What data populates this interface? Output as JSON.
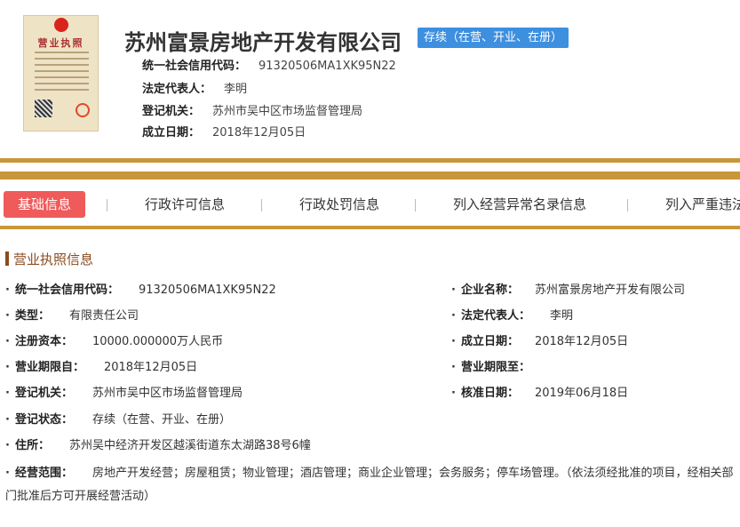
{
  "header": {
    "license_image": {
      "title": "营业执照"
    },
    "company_name": "苏州富景房地产开发有限公司",
    "status_tag": "存续（在营、开业、在册）",
    "credit_code_label": "统一社会信用代码：",
    "credit_code": "91320506MA1XK95N22",
    "legal_rep_label": "法定代表人：",
    "legal_rep": "李明",
    "authority_label": "登记机关：",
    "authority": "苏州市吴中区市场监督管理局",
    "founded_label": "成立日期：",
    "founded": "2018年12月05日"
  },
  "tabs": [
    {
      "label": "基础信息"
    },
    {
      "label": "行政许可信息"
    },
    {
      "label": "行政处罚信息"
    },
    {
      "label": "列入经营异常名录信息"
    },
    {
      "label": "列入严重违法"
    }
  ],
  "section": {
    "title": "营业执照信息"
  },
  "fields": {
    "credit_code": {
      "label": "统一社会信用代码：",
      "value": "91320506MA1XK95N22"
    },
    "company_name": {
      "label": "企业名称：",
      "value": "苏州富景房地产开发有限公司"
    },
    "type": {
      "label": "类型：",
      "value": "有限责任公司"
    },
    "legal_rep": {
      "label": "法定代表人：",
      "value": "李明"
    },
    "capital": {
      "label": "注册资本：",
      "value": "10000.000000万人民币"
    },
    "founded": {
      "label": "成立日期：",
      "value": "2018年12月05日"
    },
    "term_from": {
      "label": "营业期限自：",
      "value": "2018年12月05日"
    },
    "term_to": {
      "label": "营业期限至：",
      "value": ""
    },
    "authority": {
      "label": "登记机关：",
      "value": "苏州市吴中区市场监督管理局"
    },
    "approval_date": {
      "label": "核准日期：",
      "value": "2019年06月18日"
    },
    "status": {
      "label": "登记状态：",
      "value": "存续（在营、开业、在册）"
    },
    "address": {
      "label": "住所：",
      "value": "苏州吴中经济开发区越溪街道东太湖路38号6幢"
    },
    "scope": {
      "label": "经营范围：",
      "value": "房地产开发经营；房屋租赁；物业管理；酒店管理；商业企业管理；会务服务；停车场管理。（依法须经批准的项目，经相关部门批准后方可开展经营活动）"
    }
  },
  "colors": {
    "accent_gold": "#c8973a",
    "active_tab": "#ef5a5a",
    "status_blue": "#3d8fe0",
    "section_brown": "#8a4b1e"
  }
}
